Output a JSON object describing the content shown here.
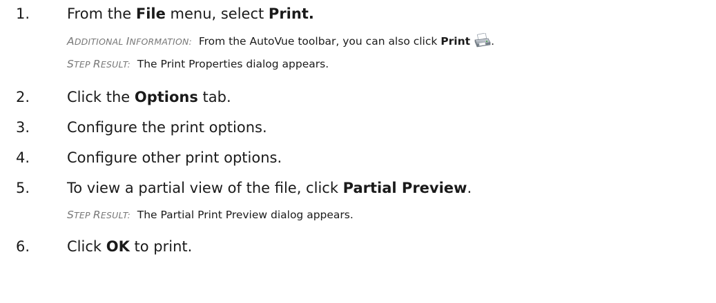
{
  "steps": [
    {
      "num": "1.",
      "pre": "From the ",
      "b1": "File",
      "mid": " menu, select ",
      "b2": "Print.",
      "additional_label_c1": "A",
      "additional_label_r1": "DDITIONAL ",
      "additional_label_c2": "I",
      "additional_label_r2": "NFORMATION:",
      "additional_pre": "From the AutoVue toolbar, you can also click ",
      "additional_bold": "Print",
      "additional_post": ".",
      "icon": "printer-icon",
      "result_label_c1": "S",
      "result_label_r1": "TEP ",
      "result_label_c2": "R",
      "result_label_r2": "ESULT:",
      "result_text": "The Print Properties dialog appears."
    },
    {
      "num": "2.",
      "pre": "Click the ",
      "bold": "Options",
      "post": " tab."
    },
    {
      "num": "3.",
      "text": "Configure the print options."
    },
    {
      "num": "4.",
      "text": "Configure other print options."
    },
    {
      "num": "5.",
      "pre": "To view a partial view of the file, click ",
      "bold": "Partial Preview",
      "post": ".",
      "result_label_c1": "S",
      "result_label_r1": "TEP ",
      "result_label_c2": "R",
      "result_label_r2": "ESULT:",
      "result_text": "The Partial Print Preview dialog appears."
    },
    {
      "num": "6.",
      "pre": "Click ",
      "bold": "OK",
      "post": " to print."
    }
  ]
}
